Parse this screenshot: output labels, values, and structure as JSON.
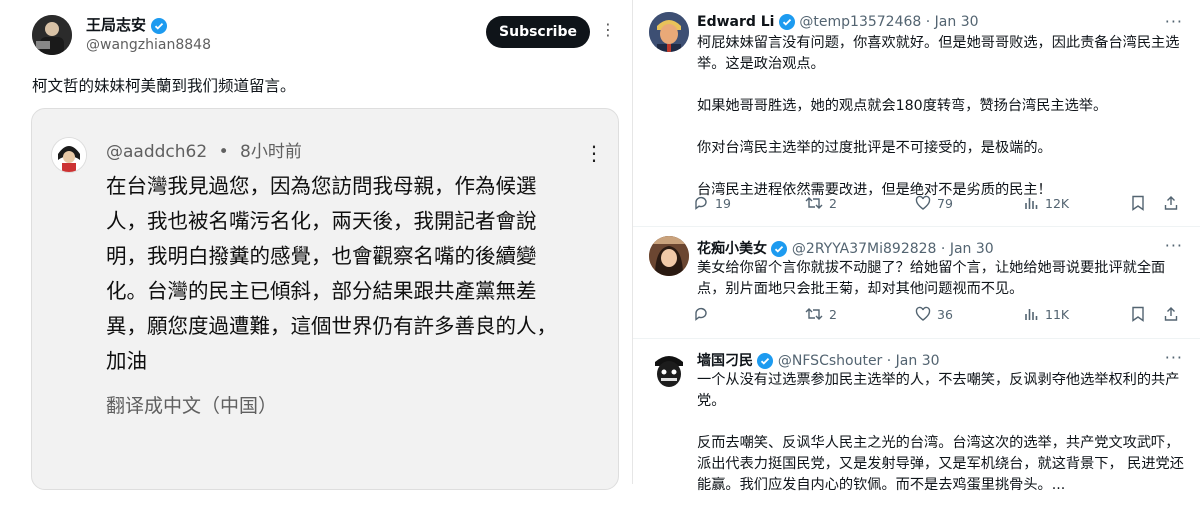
{
  "left": {
    "author_name": "王局志安",
    "author_handle": "@wangzhian8848",
    "subscribe_label": "Subscribe",
    "post_text": "柯文哲的妹妹柯美蘭到我们频道留言。",
    "quoted": {
      "handle": "@aaddch62",
      "dot": "•",
      "time": "8小时前",
      "lines": [
        "在台灣我見過您，因為您訪問我母親，作為候選",
        "人，我也被名嘴污名化，兩天後，我開記者會說",
        "明，我明白撥糞的感覺，也會觀察名嘴的後續變",
        "化。台灣的民主已傾斜，部分結果跟共產黨無差",
        "異，願您度過遭難，這個世界仍有許多善良的人，",
        "加油"
      ],
      "translate": "翻译成中文（中国）"
    }
  },
  "right": {
    "tweets": [
      {
        "name": "Edward Li",
        "handle": "@temp13572468",
        "date": "Jan 30",
        "paras": [
          "柯屁妹妹留言没有问题，你喜欢就好。但是她哥哥败选，因此责备台湾民主选举。这是政治观点。",
          "如果她哥哥胜选，她的观点就会180度转弯，赞扬台湾民主选举。",
          "你对台湾民主选举的过度批评是不可接受的，是极端的。",
          "台湾民主进程依然需要改进，但是绝对不是劣质的民主！"
        ],
        "replies": "19",
        "retweets": "2",
        "likes": "79",
        "views": "12K"
      },
      {
        "name": "花痴小美女",
        "handle": "@2RYYA37Mi892828",
        "date": "Jan 30",
        "paras": [
          "美女给你留个言你就拔不动腿了？给她留个言，让她给她哥说要批评就全面点，别片面地只会批王菊，却对其他问题视而不见。"
        ],
        "replies": "",
        "retweets": "2",
        "likes": "36",
        "views": "11K"
      },
      {
        "name": "墙国刁民",
        "handle": "@NFSCshouter",
        "date": "Jan 30",
        "paras": [
          "一个从没有过选票参加民主选举的人，不去嘲笑，反讽剥夺他选举权利的共产党。",
          "反而去嘲笑、反讽华人民主之光的台湾。台湾这次的选举，共产党文攻武吓，派出代表力挺国民党，又是发射导弹，又是军机绕台，就这背景下， 民进党还能赢。我们应发自内心的钦佩。而不是去鸡蛋里挑骨头。..."
        ]
      }
    ]
  },
  "colors": {
    "verified": "#1d9bf0",
    "button_bg": "#0f1419",
    "muted": "#536471"
  }
}
